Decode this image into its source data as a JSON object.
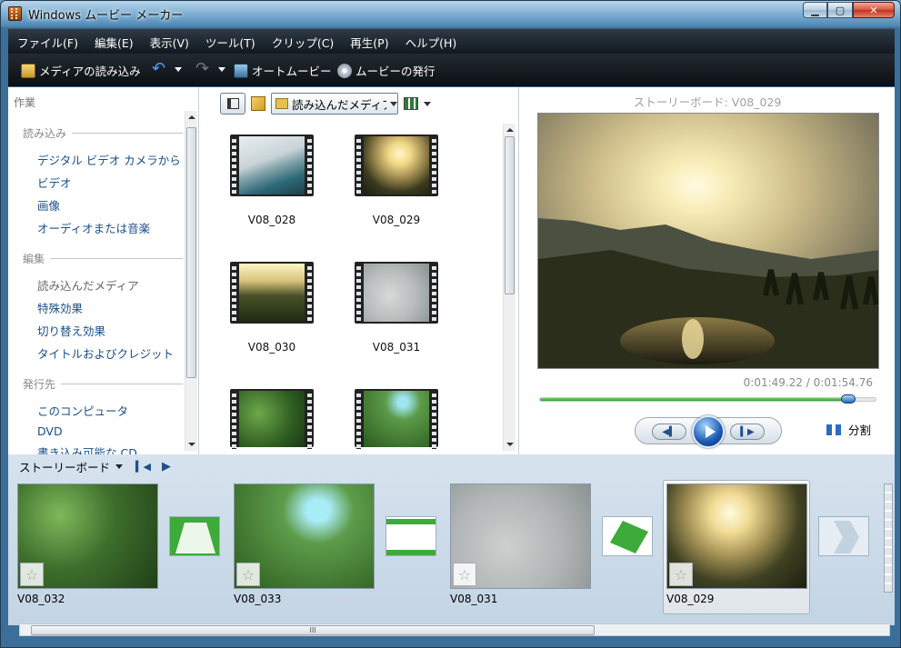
{
  "window": {
    "title": "Windows ムービー メーカー",
    "min": "▁",
    "max": "▢",
    "close": "✕"
  },
  "menu": [
    "ファイル(F)",
    "編集(E)",
    "表示(V)",
    "ツール(T)",
    "クリップ(C)",
    "再生(P)",
    "ヘルプ(H)"
  ],
  "toolbar": {
    "import": "メディアの読み込み",
    "automovie": "オートムービー",
    "publish": "ムービーの発行"
  },
  "tasks": {
    "header": "作業",
    "sections": [
      {
        "title": "読み込み",
        "items": [
          "デジタル ビデオ カメラから",
          "ビデオ",
          "画像",
          "オーディオまたは音楽"
        ]
      },
      {
        "title": "編集",
        "items": [
          "読み込んだメディア",
          "特殊効果",
          "切り替え効果",
          "タイトルおよびクレジット"
        ]
      },
      {
        "title": "発行先",
        "items": [
          "このコンピュータ",
          "DVD",
          "書き込み可能な CD"
        ]
      }
    ]
  },
  "content": {
    "combo": "読み込んだメディア",
    "clips": [
      "V08_028",
      "V08_029",
      "V08_030",
      "V08_031",
      "",
      ""
    ]
  },
  "monitor": {
    "title": "ストーリーボード: V08_029",
    "time": "0:01:49.22 / 0:01:54.76",
    "seek": 0.92,
    "split": "分割"
  },
  "storyboard": {
    "label": "ストーリーボード",
    "shots": [
      "V08_032",
      "V08_033",
      "V08_031",
      "V08_029"
    ]
  },
  "hscroll_grip": "III"
}
